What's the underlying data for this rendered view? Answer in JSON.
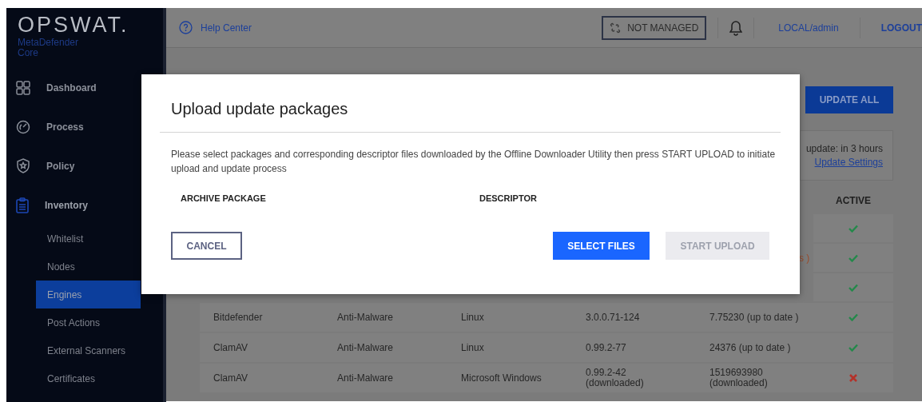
{
  "sidebar": {
    "logo": "OPSWAT.",
    "product": "MetaDefender",
    "edition": "Core",
    "items": [
      {
        "label": "Dashboard",
        "expanded": false
      },
      {
        "label": "Process",
        "expanded": false
      },
      {
        "label": "Policy",
        "expanded": false
      },
      {
        "label": "Inventory",
        "expanded": true,
        "children": [
          {
            "label": "Whitelist",
            "selected": false
          },
          {
            "label": "Nodes",
            "selected": false
          },
          {
            "label": "Engines",
            "selected": true
          },
          {
            "label": "Post Actions",
            "selected": false
          },
          {
            "label": "External Scanners",
            "selected": false
          },
          {
            "label": "Certificates",
            "selected": false
          }
        ]
      }
    ]
  },
  "header": {
    "help": "Help Center",
    "management": "NOT MANAGED",
    "user": "LOCAL/admin",
    "logout": "LOGOUT"
  },
  "update_all": "UPDATE ALL",
  "update_status": {
    "text": "update: in 3 hours",
    "link": "Update Settings"
  },
  "table": {
    "columns": [
      "ACTIVE"
    ],
    "covered_rows": [
      {
        "fragment": "",
        "active": true
      },
      {
        "fragment": "s )",
        "active": true
      },
      {
        "fragment": "",
        "active": true
      }
    ],
    "rows": [
      {
        "cells": [
          "Bitdefender",
          "Anti-Malware",
          "Linux",
          "3.0.0.71-124",
          "7.75230 (up to date )"
        ],
        "active": true
      },
      {
        "cells": [
          "ClamAV",
          "Anti-Malware",
          "Linux",
          "0.99.2-77",
          "24376 (up to date )"
        ],
        "active": true
      },
      {
        "cells": [
          "ClamAV",
          "Anti-Malware",
          "Microsoft Windows",
          "0.99.2-42 (downloaded)",
          "1519693980 (downloaded)"
        ],
        "active": false
      }
    ]
  },
  "dialog": {
    "title": "Upload update packages",
    "message": "Please select packages and corresponding descriptor files downloaded by the Offline Downloader Utility then press START UPLOAD to initiate upload and update process",
    "columns": [
      "ARCHIVE PACKAGE",
      "DESCRIPTOR"
    ],
    "buttons": [
      {
        "label": "CANCEL",
        "kind": "outline",
        "disabled": false
      },
      {
        "label": "SELECT FILES",
        "kind": "primary",
        "disabled": false
      },
      {
        "label": "START UPLOAD",
        "kind": "primary",
        "disabled": true
      }
    ]
  }
}
